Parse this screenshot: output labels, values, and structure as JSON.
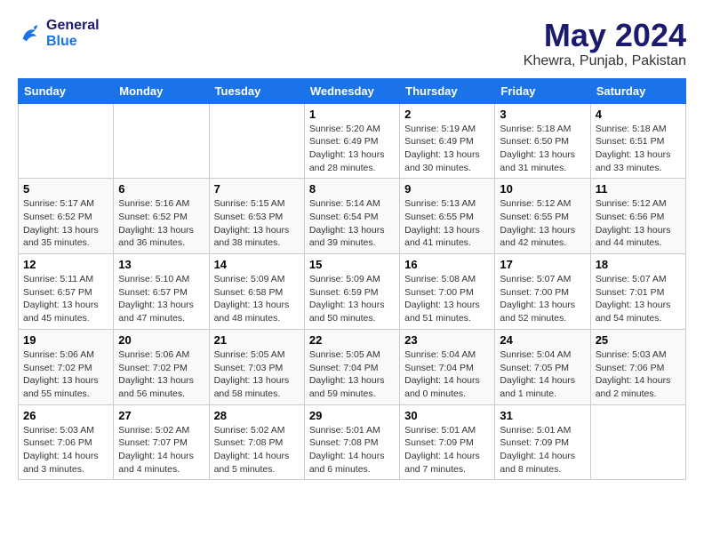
{
  "logo": {
    "line1": "General",
    "line2": "Blue"
  },
  "title": "May 2024",
  "location": "Khewra, Punjab, Pakistan",
  "weekdays": [
    "Sunday",
    "Monday",
    "Tuesday",
    "Wednesday",
    "Thursday",
    "Friday",
    "Saturday"
  ],
  "weeks": [
    [
      {
        "day": "",
        "info": ""
      },
      {
        "day": "",
        "info": ""
      },
      {
        "day": "",
        "info": ""
      },
      {
        "day": "1",
        "info": "Sunrise: 5:20 AM\nSunset: 6:49 PM\nDaylight: 13 hours and 28 minutes."
      },
      {
        "day": "2",
        "info": "Sunrise: 5:19 AM\nSunset: 6:49 PM\nDaylight: 13 hours and 30 minutes."
      },
      {
        "day": "3",
        "info": "Sunrise: 5:18 AM\nSunset: 6:50 PM\nDaylight: 13 hours and 31 minutes."
      },
      {
        "day": "4",
        "info": "Sunrise: 5:18 AM\nSunset: 6:51 PM\nDaylight: 13 hours and 33 minutes."
      }
    ],
    [
      {
        "day": "5",
        "info": "Sunrise: 5:17 AM\nSunset: 6:52 PM\nDaylight: 13 hours and 35 minutes."
      },
      {
        "day": "6",
        "info": "Sunrise: 5:16 AM\nSunset: 6:52 PM\nDaylight: 13 hours and 36 minutes."
      },
      {
        "day": "7",
        "info": "Sunrise: 5:15 AM\nSunset: 6:53 PM\nDaylight: 13 hours and 38 minutes."
      },
      {
        "day": "8",
        "info": "Sunrise: 5:14 AM\nSunset: 6:54 PM\nDaylight: 13 hours and 39 minutes."
      },
      {
        "day": "9",
        "info": "Sunrise: 5:13 AM\nSunset: 6:55 PM\nDaylight: 13 hours and 41 minutes."
      },
      {
        "day": "10",
        "info": "Sunrise: 5:12 AM\nSunset: 6:55 PM\nDaylight: 13 hours and 42 minutes."
      },
      {
        "day": "11",
        "info": "Sunrise: 5:12 AM\nSunset: 6:56 PM\nDaylight: 13 hours and 44 minutes."
      }
    ],
    [
      {
        "day": "12",
        "info": "Sunrise: 5:11 AM\nSunset: 6:57 PM\nDaylight: 13 hours and 45 minutes."
      },
      {
        "day": "13",
        "info": "Sunrise: 5:10 AM\nSunset: 6:57 PM\nDaylight: 13 hours and 47 minutes."
      },
      {
        "day": "14",
        "info": "Sunrise: 5:09 AM\nSunset: 6:58 PM\nDaylight: 13 hours and 48 minutes."
      },
      {
        "day": "15",
        "info": "Sunrise: 5:09 AM\nSunset: 6:59 PM\nDaylight: 13 hours and 50 minutes."
      },
      {
        "day": "16",
        "info": "Sunrise: 5:08 AM\nSunset: 7:00 PM\nDaylight: 13 hours and 51 minutes."
      },
      {
        "day": "17",
        "info": "Sunrise: 5:07 AM\nSunset: 7:00 PM\nDaylight: 13 hours and 52 minutes."
      },
      {
        "day": "18",
        "info": "Sunrise: 5:07 AM\nSunset: 7:01 PM\nDaylight: 13 hours and 54 minutes."
      }
    ],
    [
      {
        "day": "19",
        "info": "Sunrise: 5:06 AM\nSunset: 7:02 PM\nDaylight: 13 hours and 55 minutes."
      },
      {
        "day": "20",
        "info": "Sunrise: 5:06 AM\nSunset: 7:02 PM\nDaylight: 13 hours and 56 minutes."
      },
      {
        "day": "21",
        "info": "Sunrise: 5:05 AM\nSunset: 7:03 PM\nDaylight: 13 hours and 58 minutes."
      },
      {
        "day": "22",
        "info": "Sunrise: 5:05 AM\nSunset: 7:04 PM\nDaylight: 13 hours and 59 minutes."
      },
      {
        "day": "23",
        "info": "Sunrise: 5:04 AM\nSunset: 7:04 PM\nDaylight: 14 hours and 0 minutes."
      },
      {
        "day": "24",
        "info": "Sunrise: 5:04 AM\nSunset: 7:05 PM\nDaylight: 14 hours and 1 minute."
      },
      {
        "day": "25",
        "info": "Sunrise: 5:03 AM\nSunset: 7:06 PM\nDaylight: 14 hours and 2 minutes."
      }
    ],
    [
      {
        "day": "26",
        "info": "Sunrise: 5:03 AM\nSunset: 7:06 PM\nDaylight: 14 hours and 3 minutes."
      },
      {
        "day": "27",
        "info": "Sunrise: 5:02 AM\nSunset: 7:07 PM\nDaylight: 14 hours and 4 minutes."
      },
      {
        "day": "28",
        "info": "Sunrise: 5:02 AM\nSunset: 7:08 PM\nDaylight: 14 hours and 5 minutes."
      },
      {
        "day": "29",
        "info": "Sunrise: 5:01 AM\nSunset: 7:08 PM\nDaylight: 14 hours and 6 minutes."
      },
      {
        "day": "30",
        "info": "Sunrise: 5:01 AM\nSunset: 7:09 PM\nDaylight: 14 hours and 7 minutes."
      },
      {
        "day": "31",
        "info": "Sunrise: 5:01 AM\nSunset: 7:09 PM\nDaylight: 14 hours and 8 minutes."
      },
      {
        "day": "",
        "info": ""
      }
    ]
  ]
}
